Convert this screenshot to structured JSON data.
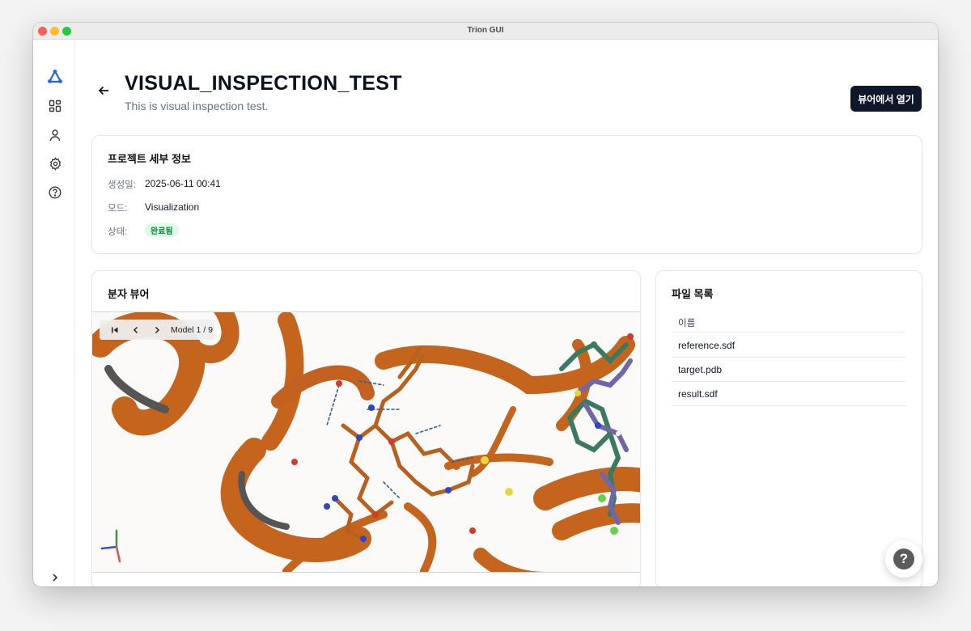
{
  "window": {
    "title": "Trion GUI"
  },
  "sidebar": {
    "items": [
      {
        "icon": "logo-icon"
      },
      {
        "icon": "dashboard-icon"
      },
      {
        "icon": "user-icon"
      },
      {
        "icon": "gear-icon"
      },
      {
        "icon": "help-circle-icon"
      }
    ],
    "expand_icon": "chevron-right-icon"
  },
  "header": {
    "title": "VISUAL_INSPECTION_TEST",
    "subtitle": "This is visual inspection test.",
    "open_viewer_label": "뷰어에서 열기"
  },
  "details": {
    "title": "프로젝트 세부 정보",
    "created_label": "생성일:",
    "created_value": "2025-06-11 00:41",
    "mode_label": "모드:",
    "mode_value": "Visualization",
    "status_label": "상태:",
    "status_value": "완료됨",
    "status_color": "#dcfce7"
  },
  "viewer": {
    "title": "분자 뷰어",
    "model_label": "Model 1 / 9",
    "controls": [
      "first-icon",
      "prev-icon",
      "next-icon"
    ]
  },
  "files": {
    "title": "파일 목록",
    "header": "이름",
    "items": [
      "reference.sdf",
      "target.pdb",
      "result.sdf"
    ]
  },
  "colors": {
    "accent": "#0f172a",
    "protein": "#c2611b",
    "ligand_green": "#3f7d64",
    "ligand_purple": "#7b72b0"
  }
}
